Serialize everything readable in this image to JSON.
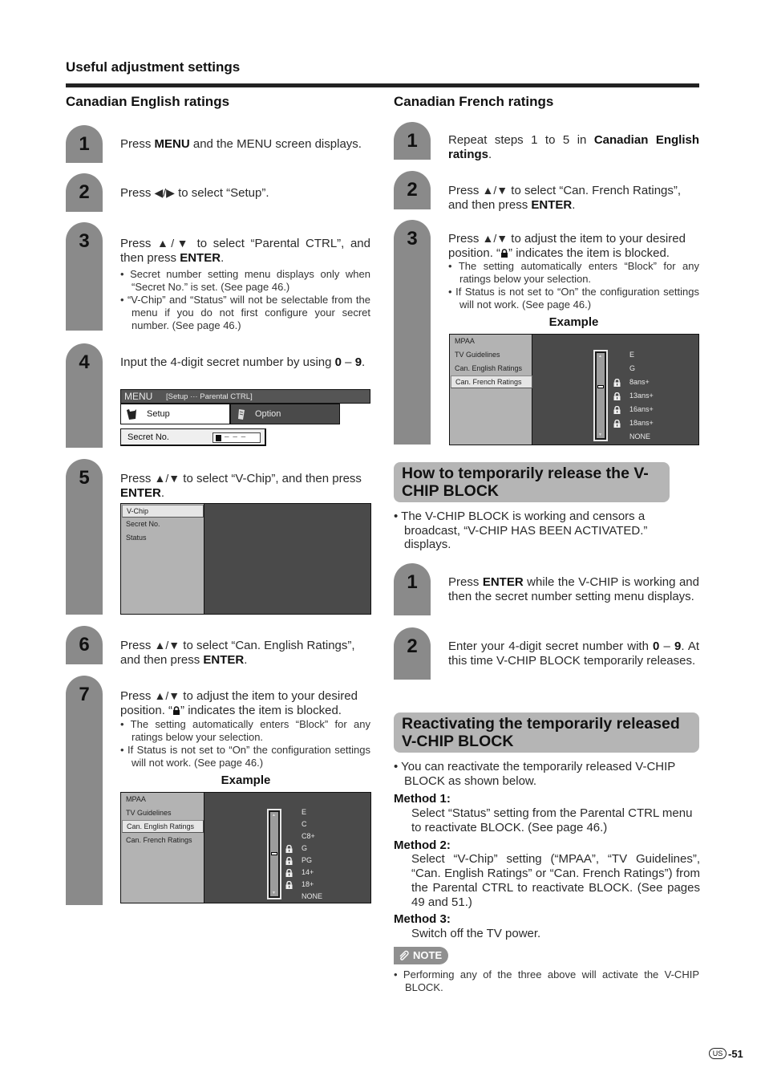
{
  "header": {
    "section_title": "Useful adjustment settings"
  },
  "english": {
    "title": "Canadian English ratings",
    "steps": [
      {
        "num": "1",
        "pre": "Press ",
        "bold": "MENU",
        "post": " and the MENU screen displays."
      },
      {
        "num": "2",
        "pre": "Press ",
        "arrows": "◀/▶",
        "post": " to select “Setup”."
      },
      {
        "num": "3",
        "pre": "Press ",
        "arrows": "▲/▼",
        "mid": " to select “Parental CTRL”, and then press ",
        "bold": "ENTER",
        "post": ".",
        "bullets": [
          "Secret number setting menu displays only when “Secret No.” is set. (See page 46.)",
          "“V-Chip” and “Status” will not be selectable from the menu if you do not first configure your secret number. (See page 46.)"
        ]
      },
      {
        "num": "4",
        "pre": "Input the 4-digit secret number by using ",
        "bold": "0",
        "mid": " – ",
        "bold2": "9",
        "post": "."
      },
      {
        "num": "5",
        "pre": "Press ",
        "arrows": "▲/▼",
        "mid": " to select “V-Chip”, and then press ",
        "bold": "ENTER",
        "post": "."
      },
      {
        "num": "6",
        "pre": "Press ",
        "arrows": "▲/▼",
        "mid": " to select “Can. English Ratings”, and then press ",
        "bold": "ENTER",
        "post": "."
      },
      {
        "num": "7",
        "pre": "Press ",
        "arrows": "▲/▼",
        "mid": " to adjust the item to your desired position. “",
        "post": "” indicates the item is blocked.",
        "bullets": [
          "The setting automatically enters “Block” for any ratings below your selection.",
          "If Status is not set to “On” the configuration settings will not work. (See page 46.)"
        ]
      }
    ],
    "menu_screen": {
      "title": "MENU",
      "breadcrumb": "[Setup ··· Parental CTRL]",
      "tabs": [
        "Setup",
        "Option"
      ],
      "field_label": "Secret No.",
      "field_value": "– – –"
    },
    "vchip_screen": {
      "items": [
        "V-Chip",
        "Secret No.",
        "Status"
      ]
    },
    "example_label": "Example",
    "example_screen": {
      "menu_items": [
        "MPAA",
        "TV Guidelines",
        "Can. English Ratings",
        "Can. French Ratings"
      ],
      "selected_index": 2,
      "ratings": [
        "E",
        "C",
        "C8+",
        "G",
        "PG",
        "14+",
        "18+",
        "NONE"
      ],
      "blocked": [
        false,
        false,
        false,
        true,
        true,
        true,
        true,
        false
      ],
      "slider_position_index": 3
    }
  },
  "french": {
    "title": "Canadian French ratings",
    "steps": [
      {
        "num": "1",
        "pre": "Repeat steps 1 to 5 in ",
        "bold": "Canadian English ratings",
        "post": "."
      },
      {
        "num": "2",
        "pre": "Press ",
        "arrows": "▲/▼",
        "mid": " to select “Can. French Ratings”, and then press ",
        "bold": "ENTER",
        "post": "."
      },
      {
        "num": "3",
        "pre": "Press ",
        "arrows": "▲/▼",
        "mid": " to adjust the item to your desired position. “",
        "post": "” indicates the item is blocked.",
        "bullets": [
          "The setting automatically enters “Block” for any ratings below your selection.",
          "If Status is not set to “On” the configuration settings will not work. (See page 46.)"
        ]
      }
    ],
    "example_label": "Example",
    "example_screen": {
      "menu_items": [
        "MPAA",
        "TV Guidelines",
        "Can. English Ratings",
        "Can. French Ratings"
      ],
      "selected_index": 3,
      "ratings": [
        "E",
        "G",
        "8ans+",
        "13ans+",
        "16ans+",
        "18ans+",
        "NONE"
      ],
      "blocked": [
        false,
        false,
        true,
        true,
        true,
        true,
        false
      ],
      "slider_position_index": 2
    }
  },
  "release": {
    "heading": "How to temporarily release the V-CHIP BLOCK",
    "bullet": "The V-CHIP BLOCK is working and censors a broadcast, “V-CHIP HAS BEEN ACTIVATED.” displays.",
    "steps": [
      {
        "num": "1",
        "pre": "Press ",
        "bold": "ENTER",
        "post": " while the V-CHIP is working and then the secret number setting menu displays."
      },
      {
        "num": "2",
        "pre": "Enter your 4-digit secret number with ",
        "bold": "0",
        "mid": " – ",
        "bold2": "9",
        "post": ". At this time V-CHIP BLOCK temporarily releases."
      }
    ]
  },
  "reactivate": {
    "heading": "Reactivating the temporarily released V-CHIP BLOCK",
    "bullet": "You can reactivate the temporarily released V-CHIP BLOCK as shown below.",
    "methods": [
      {
        "label": "Method 1:",
        "text": "Select “Status” setting from the Parental CTRL menu to reactivate BLOCK. (See page 46.)"
      },
      {
        "label": "Method 2:",
        "text": "Select “V-Chip” setting (“MPAA”, “TV Guidelines”, “Can. English Ratings” or “Can. French Ratings”) from the Parental CTRL to reactivate BLOCK. (See pages 49 and 51.)"
      },
      {
        "label": "Method 3:",
        "text": "Switch off the TV power."
      }
    ],
    "note_label": "NOTE",
    "note_text": "Performing any of the three above will activate the V-CHIP BLOCK."
  },
  "footer": {
    "region_badge": "US",
    "page_number": "-51"
  }
}
